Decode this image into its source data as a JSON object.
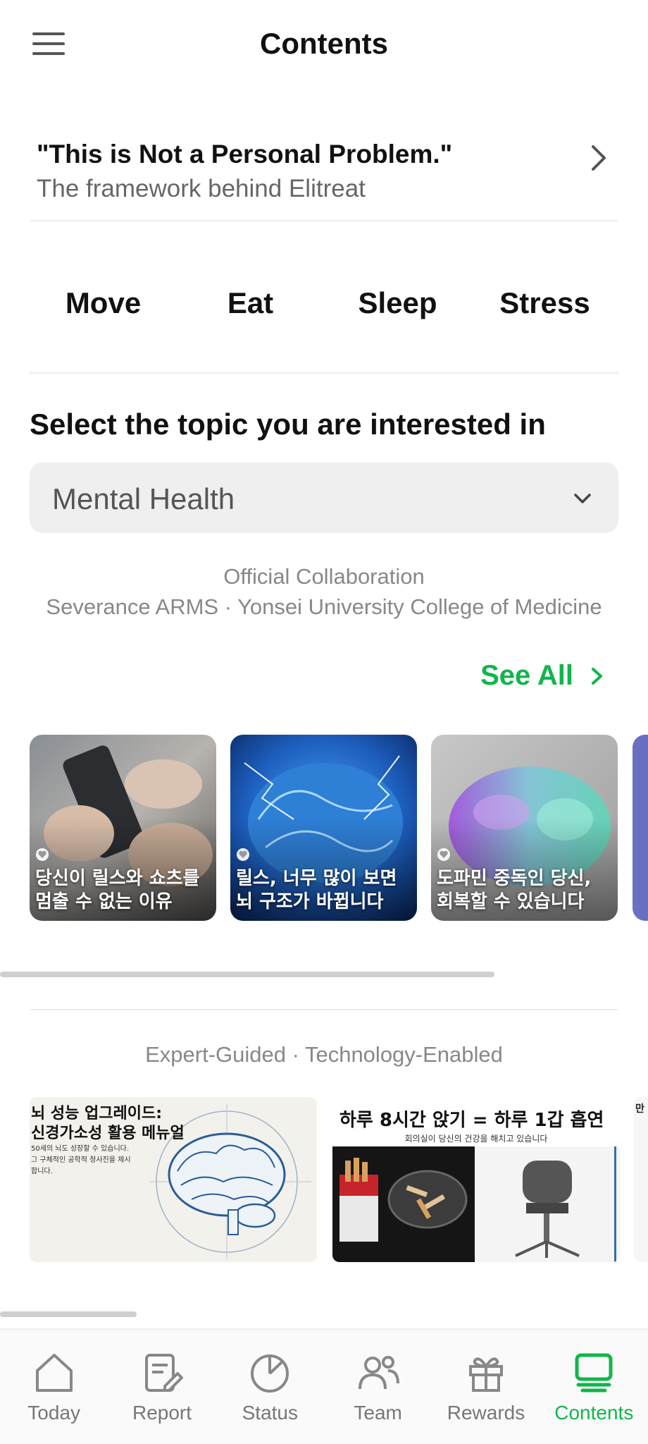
{
  "header": {
    "title": "Contents",
    "menu_icon": "hamburger-menu-icon"
  },
  "banner": {
    "title": "\"This is Not a Personal Problem.\"",
    "subtitle": "The framework behind Elitreat"
  },
  "category_tabs": [
    {
      "label": "Move"
    },
    {
      "label": "Eat"
    },
    {
      "label": "Sleep"
    },
    {
      "label": "Stress"
    }
  ],
  "topic": {
    "heading": "Select the topic you are interested in",
    "selected": "Mental Health"
  },
  "collaboration": {
    "line1": "Official Collaboration",
    "line2": "Severance ARMS · Yonsei University College of Medicine"
  },
  "see_all": {
    "label": "See All"
  },
  "cards": [
    {
      "title": "당신이 릴스와 쇼츠를 멈출 수 없는 이유"
    },
    {
      "title": "릴스, 너무 많이 보면 뇌 구조가 바뀝니다"
    },
    {
      "title": "도파민 중독인 당신, 회복할 수 있습니다"
    }
  ],
  "expert": {
    "label": "Expert-Guided · Technology-Enabled"
  },
  "posters": [
    {
      "title_line1": "뇌 성능 업그레이드:",
      "title_line2": "신경가소성 활용 메뉴얼",
      "small_text": "50세의 뇌도 성장할 수 있습니다. 그 구체적인 공학적 청사진을 제시합니다."
    },
    {
      "title": "하루 8시간 앉기 = 하루 1갑 흡연",
      "subtitle": "회의실이 당신의 건강을 해치고 있습니다"
    },
    {
      "title": "만"
    }
  ],
  "bottom_nav": [
    {
      "label": "Today",
      "icon": "home-icon"
    },
    {
      "label": "Report",
      "icon": "report-edit-icon"
    },
    {
      "label": "Status",
      "icon": "pie-chart-icon"
    },
    {
      "label": "Team",
      "icon": "team-people-icon"
    },
    {
      "label": "Rewards",
      "icon": "gift-icon"
    },
    {
      "label": "Contents",
      "icon": "contents-monitor-icon",
      "active": true
    }
  ],
  "colors": {
    "accent": "#12b54a",
    "text_muted": "#888888",
    "select_bg": "#efefef"
  }
}
